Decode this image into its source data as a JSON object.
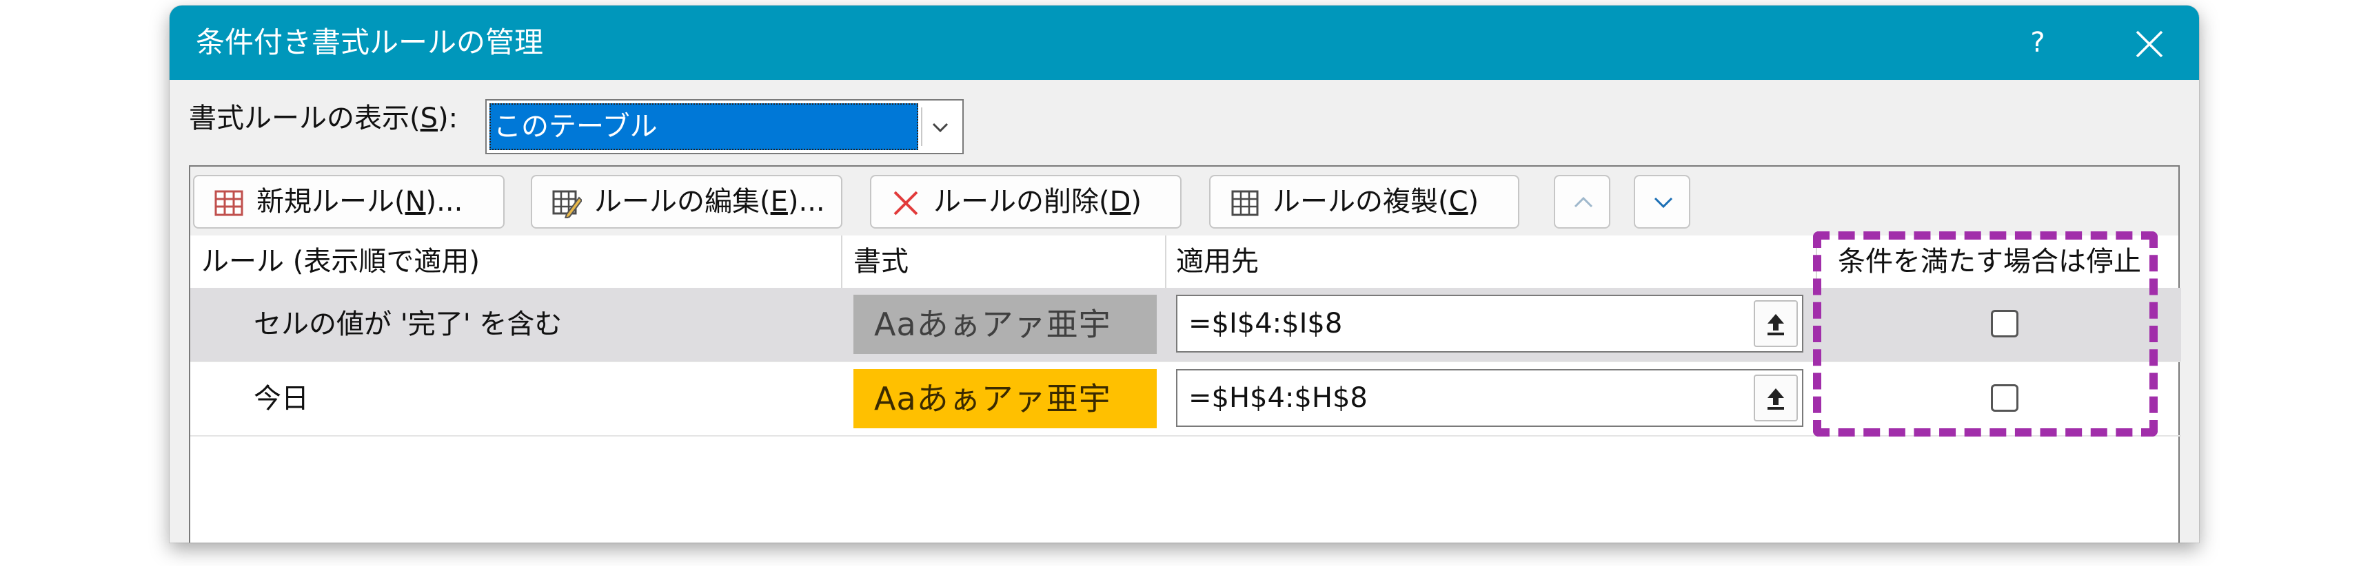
{
  "dialog": {
    "title": "条件付き書式ルールの管理",
    "help": "?"
  },
  "show_rules": {
    "label_prefix": "書式ルールの表示(",
    "label_key": "S",
    "label_suffix": "):",
    "selected": "このテーブル"
  },
  "toolbar": {
    "new_rule": {
      "prefix": "新規ルール(",
      "key": "N",
      "suffix": ")..."
    },
    "edit_rule": {
      "prefix": "ルールの編集(",
      "key": "E",
      "suffix": ")..."
    },
    "delete_rule": {
      "prefix": "ルールの削除(",
      "key": "D",
      "suffix": ")"
    },
    "duplicate_rule": {
      "prefix": "ルールの複製(",
      "key": "C",
      "suffix": ")"
    }
  },
  "columns": [
    "ルール (表示順で適用)",
    "書式",
    "適用先",
    "条件を満たす場合は停止"
  ],
  "rules": [
    {
      "name": "セルの値が '完了' を含む",
      "preview": "Aaあぁアァ亜宇",
      "applies_to": "=$I$4:$I$8",
      "stop_if_true": false,
      "selected": true,
      "preview_bg": "#b0b0b0",
      "preview_fg": "#404040"
    },
    {
      "name": "今日",
      "preview": "Aaあぁアァ亜宇",
      "applies_to": "=$H$4:$H$8",
      "stop_if_true": false,
      "selected": false,
      "preview_bg": "#ffc000",
      "preview_fg": "#3a2a00"
    }
  ],
  "colors": {
    "titlebar": "#0097bb",
    "highlight": "#a12eaa",
    "selection": "#0078d7"
  }
}
